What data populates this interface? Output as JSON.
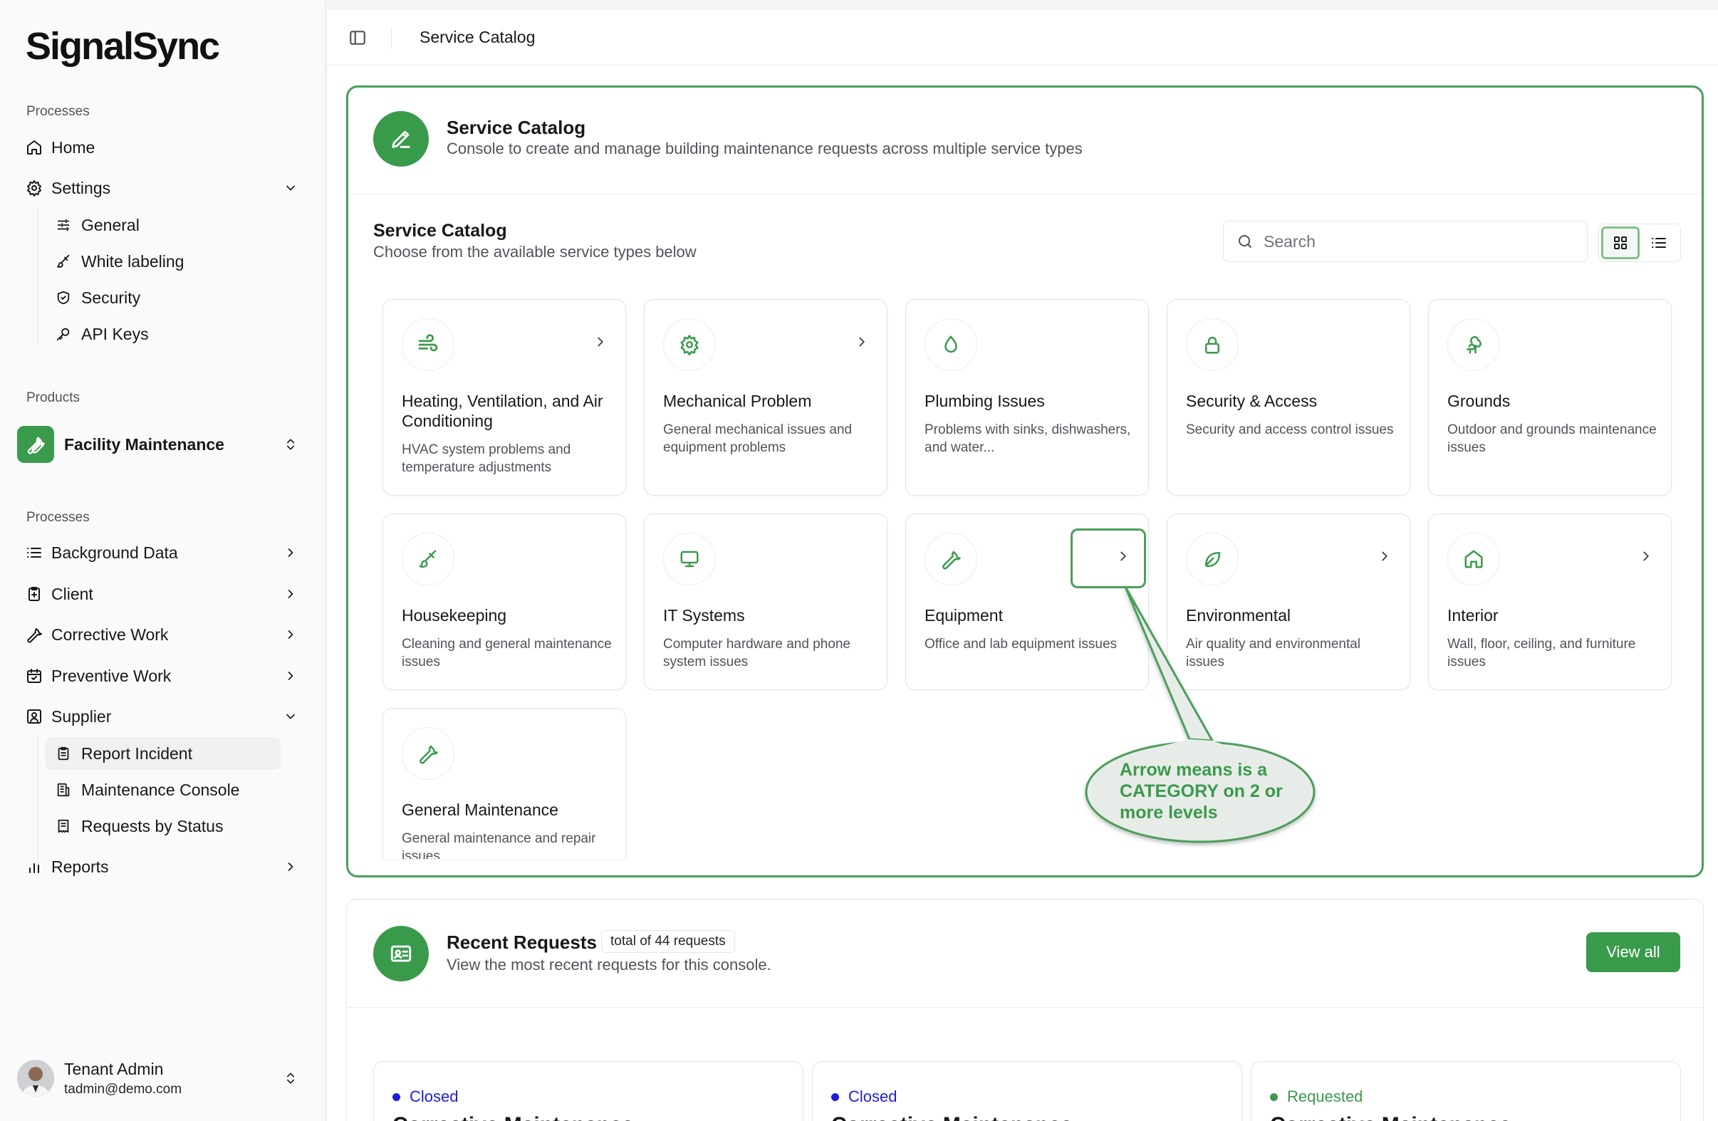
{
  "brand": {
    "logo": "SignalSync",
    "accent": "#3a9a4c"
  },
  "sidebar": {
    "section_processes": "Processes",
    "home": "Home",
    "settings": "Settings",
    "settings_items": [
      "General",
      "White labeling",
      "Security",
      "API Keys"
    ],
    "section_products": "Products",
    "product": "Facility Maintenance",
    "section_processes2": "Processes",
    "nav": [
      "Background Data",
      "Client",
      "Corrective Work",
      "Preventive Work",
      "Supplier"
    ],
    "supplier_items": [
      "Report Incident",
      "Maintenance Console",
      "Requests by Status"
    ],
    "reports": "Reports",
    "user": {
      "name": "Tenant Admin",
      "email": "tadmin@demo.com"
    }
  },
  "topbar": {
    "breadcrumb": "Service Catalog"
  },
  "catalog": {
    "title": "Service Catalog",
    "subtitle": "Console to create and manage building maintenance requests across multiple service types",
    "section_title": "Service Catalog",
    "section_subtitle": "Choose from the available service types below",
    "search_placeholder": "Search",
    "tiles": [
      {
        "name": "Heating, Ventilation, and Air Conditioning",
        "desc": "HVAC system problems and temperature adjustments",
        "icon": "wind-icon",
        "category": true
      },
      {
        "name": "Mechanical Problem",
        "desc": "General mechanical issues and equipment problems",
        "icon": "gear-icon",
        "category": true
      },
      {
        "name": "Plumbing Issues",
        "desc": "Problems with sinks, dishwashers, and water...",
        "icon": "droplet-icon",
        "category": false
      },
      {
        "name": "Security & Access",
        "desc": "Security and access control issues",
        "icon": "lock-icon",
        "category": false
      },
      {
        "name": "Grounds",
        "desc": "Outdoor and grounds maintenance issues",
        "icon": "trees-icon",
        "category": false
      },
      {
        "name": "Housekeeping",
        "desc": "Cleaning and general maintenance issues",
        "icon": "brush-icon",
        "category": false
      },
      {
        "name": "IT Systems",
        "desc": "Computer hardware and phone system issues",
        "icon": "monitor-icon",
        "category": false
      },
      {
        "name": "Equipment",
        "desc": "Office and lab equipment issues",
        "icon": "wrench-icon",
        "category": true
      },
      {
        "name": "Environmental",
        "desc": "Air quality and environmental issues",
        "icon": "leaf-icon",
        "category": true
      },
      {
        "name": "Interior",
        "desc": "Wall, floor, ceiling, and furniture issues",
        "icon": "house-icon",
        "category": true
      },
      {
        "name": "General Maintenance",
        "desc": "General maintenance and repair issues",
        "icon": "wrench-icon",
        "category": false
      }
    ]
  },
  "callout": {
    "text": "Arrow means is a CATEGORY on 2 or more levels"
  },
  "recent": {
    "title": "Recent Requests",
    "badge": "total of 44 requests",
    "subtitle": "View the most recent requests for this console.",
    "view_all": "View all",
    "items": [
      {
        "status": "Closed",
        "status_color": "#1d1de0",
        "title": "Corrective Maintenance"
      },
      {
        "status": "Closed",
        "status_color": "#1d1de0",
        "title": "Corrective Maintenance"
      },
      {
        "status": "Requested",
        "status_color": "#3a9a4c",
        "title": "Corrective Maintenance"
      }
    ]
  }
}
